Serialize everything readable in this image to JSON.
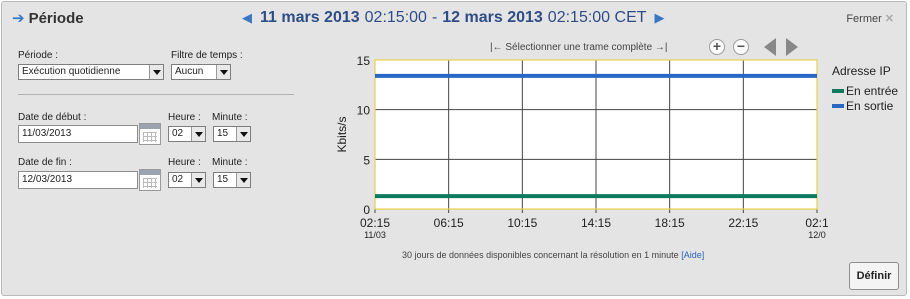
{
  "header": {
    "title": "Période",
    "range_start_date": "11 mars 2013",
    "range_start_time": "02:15:00",
    "range_sep": "-",
    "range_end_date": "12 mars 2013",
    "range_end_time": "02:15:00 CET",
    "close_label": "Fermer",
    "close_glyph": "✕"
  },
  "form": {
    "period_label": "Période :",
    "period_value": "Exécution quotidienne",
    "filter_label": "Filtre de temps :",
    "filter_value": "Aucun",
    "start_label": "Date de début :",
    "start_date": "11/03/2013",
    "start_hour_label": "Heure :",
    "start_hour": "02",
    "start_minute_label": "Minute :",
    "start_minute": "15",
    "end_label": "Date de fin :",
    "end_date": "12/03/2013",
    "end_hour_label": "Heure :",
    "end_hour": "02",
    "end_minute_label": "Minute :",
    "end_minute": "15"
  },
  "toolbar": {
    "select_frame_label": "|← Sélectionner une trame complète →|",
    "zoom_in": "+",
    "zoom_out": "−"
  },
  "legend": {
    "title": "Adresse IP",
    "items": [
      "En entrée",
      "En sortie"
    ]
  },
  "footer": {
    "note": "30 jours de données disponibles concernant la résolution en 1 minute",
    "help_link": "[Aide]",
    "submit_label": "Définir"
  },
  "colors": {
    "in": "#0d7a5f",
    "out": "#2767c6",
    "plot_border": "#e6d24a"
  },
  "chart_data": {
    "type": "line",
    "ylabel": "Kbits/s",
    "ylim": [
      0,
      15
    ],
    "yticks": [
      "0",
      "5",
      "10",
      "15"
    ],
    "xticks": [
      {
        "time": "02:15",
        "date": "11/03"
      },
      {
        "time": "06:15",
        "date": ""
      },
      {
        "time": "10:15",
        "date": ""
      },
      {
        "time": "14:15",
        "date": ""
      },
      {
        "time": "18:15",
        "date": ""
      },
      {
        "time": "22:15",
        "date": ""
      },
      {
        "time": "02:1",
        "date": "12/0"
      }
    ],
    "grid": true,
    "series": [
      {
        "name": "En entrée",
        "values": [
          1.3,
          1.3
        ]
      },
      {
        "name": "En sortie",
        "values": [
          13.4,
          13.4
        ]
      }
    ]
  }
}
